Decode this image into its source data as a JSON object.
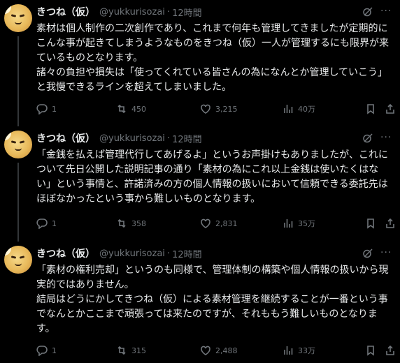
{
  "tweets": [
    {
      "name": "きつね（仮）",
      "handle": "@yukkurisozai",
      "dot": "·",
      "time": "12時間",
      "text": "素材は個人制作の二次創作であり、これまで何年も管理してきましたが定期的にこんな事が起きてしまうようなものをきつね（仮）一人が管理するにも限界が来ているものとなります。\n諸々の負担や損失は「使ってくれている皆さんの為になんとか管理していこう」と我慢できるラインを超えてしまいました。",
      "replies": "1",
      "reposts": "450",
      "likes": "3,215",
      "views": "40万"
    },
    {
      "name": "きつね（仮）",
      "handle": "@yukkurisozai",
      "dot": "·",
      "time": "12時間",
      "text": "「金銭を払えば管理代行してあげるよ」というお声掛けもありましたが、これについて先日公開した説明記事の通り「素材の為にこれ以上金銭は使いたくはない」という事情と、許諾済みの方の個人情報の扱いにおいて信頼できる委託先はほぼなかったという事から難しいものとなります。",
      "replies": "1",
      "reposts": "358",
      "likes": "2,831",
      "views": "35万"
    },
    {
      "name": "きつね（仮）",
      "handle": "@yukkurisozai",
      "dot": "·",
      "time": "12時間",
      "text": "「素材の権利売却」というのも同様で、管理体制の構築や個人情報の扱いから現実的ではありません。\n結局はどうにかしてきつね（仮）による素材管理を継続することが一番という事でなんとかここまで頑張っては来たのですが、それももう難しいものとなります。",
      "replies": "1",
      "reposts": "315",
      "likes": "2,488",
      "views": "33万"
    }
  ],
  "icons": {
    "reply": "reply-icon",
    "repost": "repost-icon",
    "like": "heart-icon",
    "views": "views-chart-icon",
    "bookmark": "bookmark-icon",
    "share": "share-icon",
    "grok": "grok-icon",
    "more": "more-icon"
  },
  "colors": {
    "background": "#000000",
    "text": "#e7e9ea",
    "muted": "#71767b",
    "divider": "#333639"
  }
}
